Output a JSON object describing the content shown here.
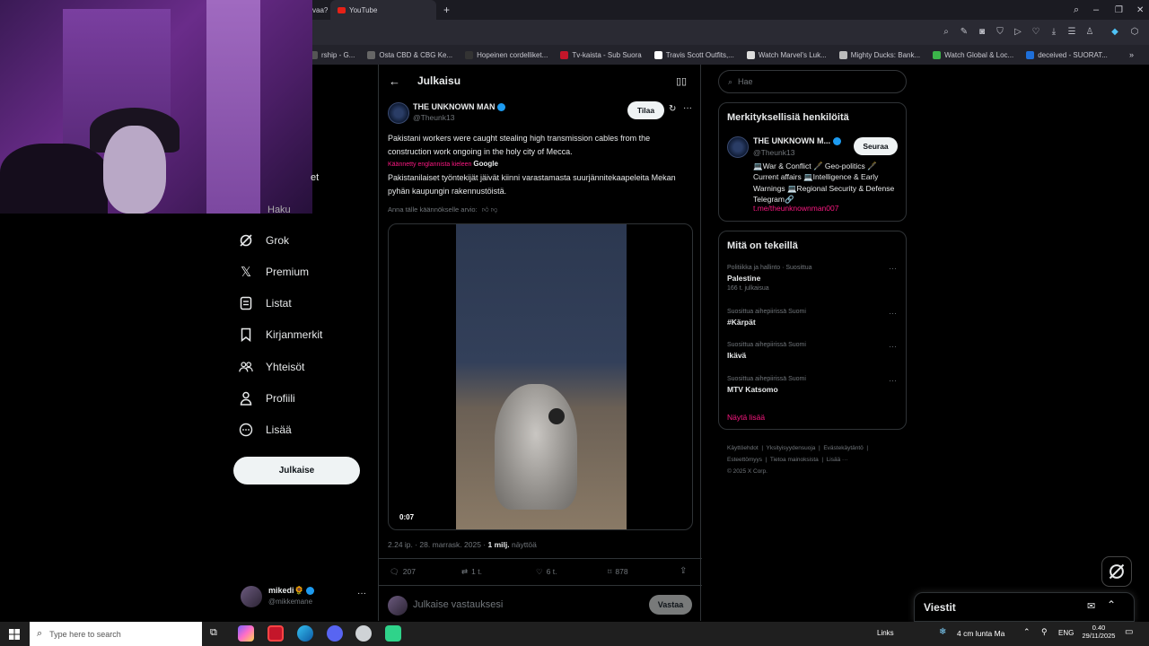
{
  "browser": {
    "tab_partial": "vaa?",
    "tab_active": "YouTube",
    "new_tab": "+",
    "bookmarks": [
      {
        "label": "rship - G...",
        "color": "#555"
      },
      {
        "label": "Osta CBD & CBG Ke...",
        "color": "#666"
      },
      {
        "label": "Hopeinen cordelliket...",
        "color": "#333"
      },
      {
        "label": "Tv-kaista - Sub Suora",
        "color": "#c4162a"
      },
      {
        "label": "Travis Scott Outfits,...",
        "color": "#fff"
      },
      {
        "label": "Watch Marvel's Luk...",
        "color": "#ddd"
      },
      {
        "label": "Mighty Ducks: Bank...",
        "color": "#bbb"
      },
      {
        "label": "Watch Global & Loc...",
        "color": "#3bb44a"
      },
      {
        "label": "deceived - SUORAT...",
        "color": "#1e6fd9"
      }
    ]
  },
  "nav": {
    "partial_label": "et",
    "partial_label_2": "Haku",
    "items": [
      {
        "label": "Grok",
        "icon": "grok-icon"
      },
      {
        "label": "Premium",
        "icon": "x-icon"
      },
      {
        "label": "Listat",
        "icon": "list-icon"
      },
      {
        "label": "Kirjanmerkit",
        "icon": "bookmark-icon"
      },
      {
        "label": "Yhteisöt",
        "icon": "communities-icon"
      },
      {
        "label": "Profiili",
        "icon": "profile-icon"
      },
      {
        "label": "Lisää",
        "icon": "more-icon"
      }
    ],
    "post_button": "Julkaise",
    "account_name": "mikedi🌻",
    "account_handle": "@mikkemane",
    "account_more": "···"
  },
  "post": {
    "header_title": "Julkaisu",
    "author_name": "THE UNKNOWN MAN",
    "author_handle": "@Theunk13",
    "subscribe": "Tilaa",
    "text": "Pakistani workers were caught stealing high transmission cables from the construction work ongoing in the holy city of Mecca.",
    "translated_from": "Käännetty englannista kieleen",
    "translated_by": "Google",
    "translation": "Pakistanilaiset työntekijät jäivät kiinni varastamasta suurjännitekaapeleita Mekan pyhän kaupungin rakennustöistä.",
    "rate_translation": "Anna tälle käännökselle arvio:",
    "video_time": "0:07",
    "timestamp": "2.24 ip. · 28. marrask. 2025 ·",
    "views_value": "1 milj.",
    "views_label": "näyttöä",
    "replies": "207",
    "reposts": "1 t.",
    "likes": "6 t.",
    "bookmarks": "878",
    "reply_placeholder": "Julkaise vastauksesi",
    "reply_button": "Vastaa"
  },
  "sidebar": {
    "search_placeholder": "Hae",
    "relevant_title": "Merkityksellisiä henkilöitä",
    "person_name": "THE UNKNOWN M...",
    "person_handle": "@Theunk13",
    "follow": "Seuraa",
    "bio": "💻War & Conflict 🖋️ Geo-politics 🖋️ Current affairs 💻Intelligence & Early Warnings 💻Regional Security & Defense Telegram🔗",
    "bio_link": "t.me/theunknownman007",
    "trends_title": "Mitä on tekeillä",
    "trends": [
      {
        "meta": "Politiikka ja hallinto · Suosittua",
        "name": "Palestine",
        "count": "166 t. julkaisua"
      },
      {
        "meta": "Suosittua aihepiirissä Suomi",
        "name": "#Kärpät",
        "count": ""
      },
      {
        "meta": "Suosittua aihepiirissä Suomi",
        "name": "Ikävä",
        "count": ""
      },
      {
        "meta": "Suosittua aihepiirissä Suomi",
        "name": "MTV Katsomo",
        "count": ""
      }
    ],
    "show_more": "Näytä lisää",
    "footer": [
      "Käyttöehdot",
      "Yksityisyydensuoja",
      "Evästekäytäntö",
      "Esteettömyys",
      "Tietoa mainoksista",
      "Lisää ···",
      "© 2025 X Corp."
    ]
  },
  "messages": {
    "title": "Viestit"
  },
  "taskbar": {
    "search_placeholder": "Type here to search",
    "links": "Links",
    "weather": "4 cm lunta Ma",
    "language": "ENG",
    "time": "0.40",
    "date": "29/11/2025"
  },
  "colors": {
    "accent": "#1d9bf0",
    "link_pink": "#f91880",
    "verified": "#1d9bf0"
  }
}
